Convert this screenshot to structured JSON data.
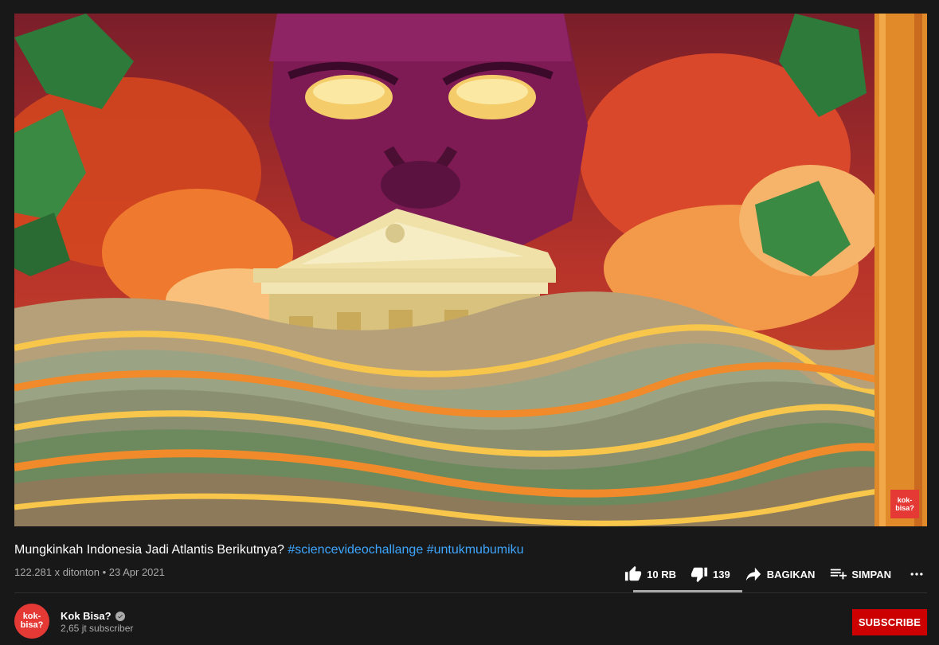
{
  "video": {
    "watermark": "kok-bisa?"
  },
  "title": {
    "text": "Mungkinkah Indonesia Jadi Atlantis Berikutnya?",
    "hashtags": [
      "#sciencevideochallange",
      "#untukmubumiku"
    ]
  },
  "meta": {
    "views_date": "122.281 x ditonton • 23 Apr 2021"
  },
  "actions": {
    "like_count": "10 RB",
    "dislike_count": "139",
    "share_label": "BAGIKAN",
    "save_label": "SIMPAN",
    "more_icon": "more-horizontal-icon",
    "like_ratio": 0.986
  },
  "channel": {
    "avatar_text": "kok-bisa?",
    "name": "Kok Bisa?",
    "subscribers": "2,65 jt subscriber",
    "subscribe_label": "SUBSCRIBE",
    "accent_color": "#cc0000"
  }
}
